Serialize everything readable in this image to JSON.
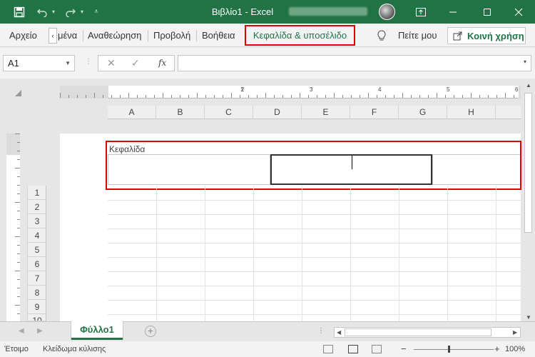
{
  "window": {
    "title": "Βιβλίο1  -  Excel",
    "accent": "#217346",
    "highlight": "#e00000"
  },
  "ribbon": {
    "tabs": [
      {
        "label": "Αρχείο"
      },
      {
        "label": "μένα"
      },
      {
        "label": "Αναθεώρηση"
      },
      {
        "label": "Προβολή"
      },
      {
        "label": "Βοήθεια"
      }
    ],
    "active_tab": "Κεφαλίδα & υποσέλιδο",
    "tell_me": "Πείτε μου",
    "share": "Κοινή χρήση"
  },
  "formula_bar": {
    "name_box": "A1",
    "fx": "fx",
    "value": ""
  },
  "ruler": {
    "numbers": [
      "1",
      "2",
      "3",
      "4",
      "5",
      "6"
    ]
  },
  "sheet": {
    "columns": [
      "A",
      "B",
      "C",
      "D",
      "E",
      "F",
      "G",
      "H"
    ],
    "rows": [
      "1",
      "2",
      "3",
      "4",
      "5",
      "6",
      "7",
      "8",
      "9",
      "10"
    ],
    "header_label": "Κεφαλίδα"
  },
  "tabs": {
    "sheets": [
      {
        "label": "Φύλλο1",
        "active": true
      }
    ]
  },
  "status": {
    "ready": "Έτοιμο",
    "scroll_lock": "Κλείδωμα κύλισης",
    "zoom": "100%"
  }
}
